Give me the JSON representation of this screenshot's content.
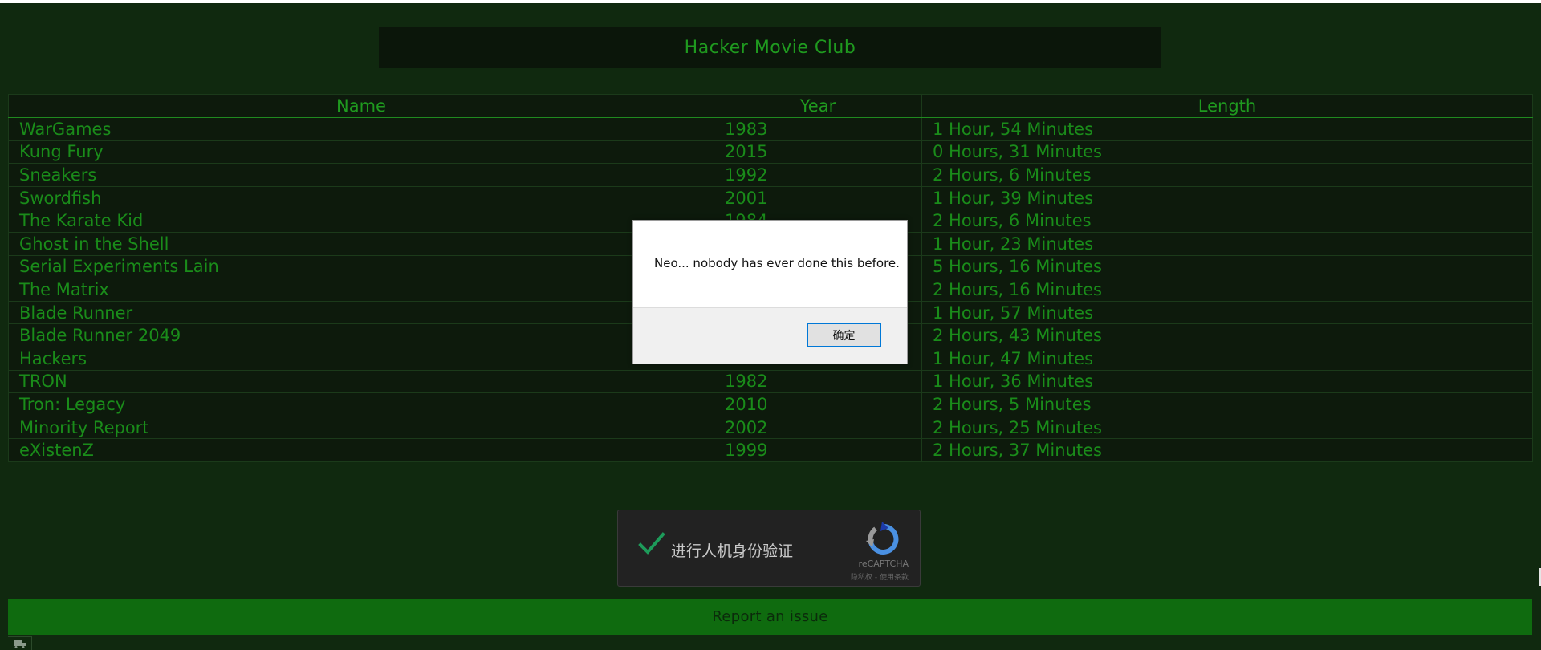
{
  "page": {
    "title": "Hacker Movie Club",
    "accent_color": "#1f9a1f",
    "background_color": "#10290f"
  },
  "table": {
    "headers": {
      "name": "Name",
      "year": "Year",
      "length": "Length"
    },
    "rows": [
      {
        "name": "WarGames",
        "year": "1983",
        "length": "1 Hour, 54 Minutes"
      },
      {
        "name": "Kung Fury",
        "year": "2015",
        "length": "0 Hours, 31 Minutes"
      },
      {
        "name": "Sneakers",
        "year": "1992",
        "length": "2 Hours, 6 Minutes"
      },
      {
        "name": "Swordfish",
        "year": "2001",
        "length": "1 Hour, 39 Minutes"
      },
      {
        "name": "The Karate Kid",
        "year": "1984",
        "length": "2 Hours, 6 Minutes"
      },
      {
        "name": "Ghost in the Shell",
        "year": "",
        "length": "1 Hour, 23 Minutes"
      },
      {
        "name": "Serial Experiments Lain",
        "year": "",
        "length": "5 Hours, 16 Minutes"
      },
      {
        "name": "The Matrix",
        "year": "",
        "length": "2 Hours, 16 Minutes"
      },
      {
        "name": "Blade Runner",
        "year": "",
        "length": "1 Hour, 57 Minutes"
      },
      {
        "name": "Blade Runner 2049",
        "year": "",
        "length": "2 Hours, 43 Minutes"
      },
      {
        "name": "Hackers",
        "year": "",
        "length": "1 Hour, 47 Minutes"
      },
      {
        "name": "TRON",
        "year": "1982",
        "length": "1 Hour, 36 Minutes"
      },
      {
        "name": "Tron: Legacy",
        "year": "2010",
        "length": "2 Hours, 5 Minutes"
      },
      {
        "name": "Minority Report",
        "year": "2002",
        "length": "2 Hours, 25 Minutes"
      },
      {
        "name": "eXistenZ",
        "year": "1999",
        "length": "2 Hours, 37 Minutes"
      }
    ]
  },
  "captcha": {
    "label": "进行人机身份验证",
    "brand": "reCAPTCHA",
    "terms": "隐私权 - 使用条款",
    "checked": true,
    "icon": "recaptcha-logo-icon"
  },
  "footer": {
    "report_label": "Report an issue",
    "icon": "truck-icon"
  },
  "dialog": {
    "message": "Neo... nobody has ever done this before.",
    "ok_label": "确定"
  }
}
